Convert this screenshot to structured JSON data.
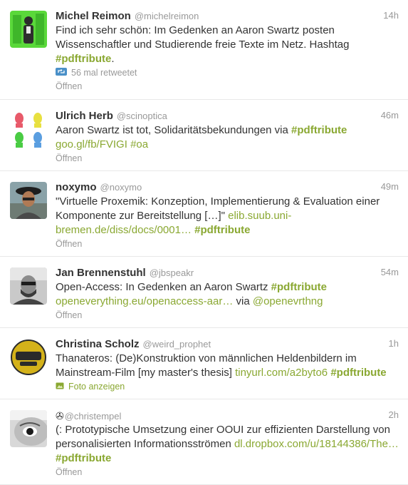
{
  "colors": {
    "link": "#8aa832",
    "muted": "#999999",
    "text": "#333333",
    "retweet_icon": "#4a90c8"
  },
  "tweets": [
    {
      "name": "Michel Reimon",
      "handle": "@michelreimon",
      "time": "14h",
      "t1": "Find ich sehr schön: Im Gedenken an Aaron Swartz posten Wissenschaftler und Studierende freie Texte im Netz. Hashtag ",
      "tag": "#pdftribute",
      "t2": ".",
      "retweets": "56 mal retweetet",
      "open": "Öffnen"
    },
    {
      "name": "Ulrich Herb",
      "handle": "@scinoptica",
      "time": "46m",
      "t1": "Aaron Swartz ist tot, Solidaritätsbekundungen via ",
      "tag": "#pdftribute",
      "link": "goo.gl/fb/FVIGI",
      "tag2": "#oa",
      "open": "Öffnen"
    },
    {
      "name": "noxymo",
      "handle": "@noxymo",
      "time": "49m",
      "t1": "\"Virtuelle Proxemik: Konzeption, Implementierung & Evaluation einer Komponente zur Bereitstellung […]\" ",
      "link": "elib.suub.uni-bremen.de/diss/docs/0001…",
      "tag": "#pdftribute",
      "open": "Öffnen"
    },
    {
      "name": "Jan Brennenstuhl",
      "handle": "@jbspeakr",
      "time": "54m",
      "t1": "Open-Access: In Gedenken an Aaron Swartz ",
      "tag": "#pdftribute",
      "link": "openeverything.eu/openaccess-aar…",
      "via": "via",
      "mention": "@openevrthng",
      "open": "Öffnen"
    },
    {
      "name": "Christina Scholz",
      "handle": "@weird_prophet",
      "time": "1h",
      "t1": "Thanateros: (De)Konstruktion von männlichen Heldenbildern im Mainstream-Film [my master's thesis] ",
      "link": "tinyurl.com/a2byto6",
      "tag": "#pdftribute",
      "photo": "Foto anzeigen"
    },
    {
      "name": "✇",
      "handle": "@christempel",
      "time": "2h",
      "t1": "(: Prototypische Umsetzung einer OOUI zur effizienten Darstellung von personalisierten Informationsströmen ",
      "link": "dl.dropbox.com/u/18144386/The…",
      "tag": "#pdftribute",
      "open": "Öffnen"
    }
  ]
}
